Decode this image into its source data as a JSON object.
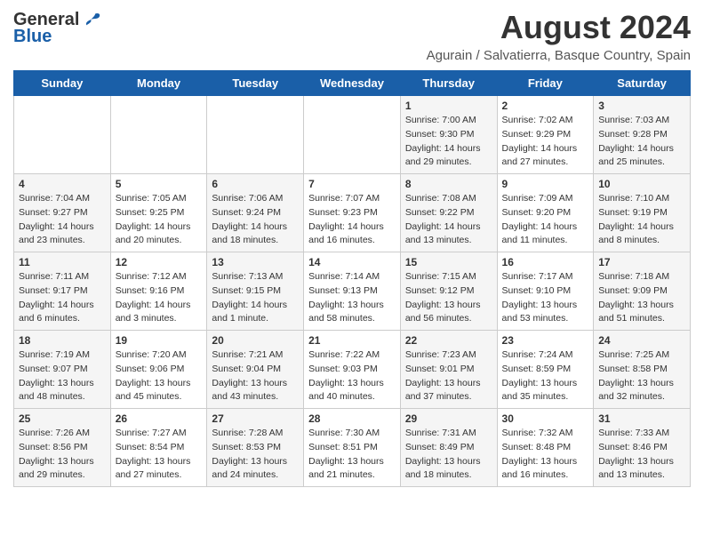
{
  "header": {
    "logo_general": "General",
    "logo_blue": "Blue",
    "month_year": "August 2024",
    "subtitle": "Agurain / Salvatierra, Basque Country, Spain"
  },
  "days_of_week": [
    "Sunday",
    "Monday",
    "Tuesday",
    "Wednesday",
    "Thursday",
    "Friday",
    "Saturday"
  ],
  "weeks": [
    [
      {
        "day": "",
        "sunrise": "",
        "sunset": "",
        "daylight": ""
      },
      {
        "day": "",
        "sunrise": "",
        "sunset": "",
        "daylight": ""
      },
      {
        "day": "",
        "sunrise": "",
        "sunset": "",
        "daylight": ""
      },
      {
        "day": "",
        "sunrise": "",
        "sunset": "",
        "daylight": ""
      },
      {
        "day": "1",
        "sunrise": "7:00 AM",
        "sunset": "9:30 PM",
        "daylight": "14 hours and 29 minutes."
      },
      {
        "day": "2",
        "sunrise": "7:02 AM",
        "sunset": "9:29 PM",
        "daylight": "14 hours and 27 minutes."
      },
      {
        "day": "3",
        "sunrise": "7:03 AM",
        "sunset": "9:28 PM",
        "daylight": "14 hours and 25 minutes."
      }
    ],
    [
      {
        "day": "4",
        "sunrise": "7:04 AM",
        "sunset": "9:27 PM",
        "daylight": "14 hours and 23 minutes."
      },
      {
        "day": "5",
        "sunrise": "7:05 AM",
        "sunset": "9:25 PM",
        "daylight": "14 hours and 20 minutes."
      },
      {
        "day": "6",
        "sunrise": "7:06 AM",
        "sunset": "9:24 PM",
        "daylight": "14 hours and 18 minutes."
      },
      {
        "day": "7",
        "sunrise": "7:07 AM",
        "sunset": "9:23 PM",
        "daylight": "14 hours and 16 minutes."
      },
      {
        "day": "8",
        "sunrise": "7:08 AM",
        "sunset": "9:22 PM",
        "daylight": "14 hours and 13 minutes."
      },
      {
        "day": "9",
        "sunrise": "7:09 AM",
        "sunset": "9:20 PM",
        "daylight": "14 hours and 11 minutes."
      },
      {
        "day": "10",
        "sunrise": "7:10 AM",
        "sunset": "9:19 PM",
        "daylight": "14 hours and 8 minutes."
      }
    ],
    [
      {
        "day": "11",
        "sunrise": "7:11 AM",
        "sunset": "9:17 PM",
        "daylight": "14 hours and 6 minutes."
      },
      {
        "day": "12",
        "sunrise": "7:12 AM",
        "sunset": "9:16 PM",
        "daylight": "14 hours and 3 minutes."
      },
      {
        "day": "13",
        "sunrise": "7:13 AM",
        "sunset": "9:15 PM",
        "daylight": "14 hours and 1 minute."
      },
      {
        "day": "14",
        "sunrise": "7:14 AM",
        "sunset": "9:13 PM",
        "daylight": "13 hours and 58 minutes."
      },
      {
        "day": "15",
        "sunrise": "7:15 AM",
        "sunset": "9:12 PM",
        "daylight": "13 hours and 56 minutes."
      },
      {
        "day": "16",
        "sunrise": "7:17 AM",
        "sunset": "9:10 PM",
        "daylight": "13 hours and 53 minutes."
      },
      {
        "day": "17",
        "sunrise": "7:18 AM",
        "sunset": "9:09 PM",
        "daylight": "13 hours and 51 minutes."
      }
    ],
    [
      {
        "day": "18",
        "sunrise": "7:19 AM",
        "sunset": "9:07 PM",
        "daylight": "13 hours and 48 minutes."
      },
      {
        "day": "19",
        "sunrise": "7:20 AM",
        "sunset": "9:06 PM",
        "daylight": "13 hours and 45 minutes."
      },
      {
        "day": "20",
        "sunrise": "7:21 AM",
        "sunset": "9:04 PM",
        "daylight": "13 hours and 43 minutes."
      },
      {
        "day": "21",
        "sunrise": "7:22 AM",
        "sunset": "9:03 PM",
        "daylight": "13 hours and 40 minutes."
      },
      {
        "day": "22",
        "sunrise": "7:23 AM",
        "sunset": "9:01 PM",
        "daylight": "13 hours and 37 minutes."
      },
      {
        "day": "23",
        "sunrise": "7:24 AM",
        "sunset": "8:59 PM",
        "daylight": "13 hours and 35 minutes."
      },
      {
        "day": "24",
        "sunrise": "7:25 AM",
        "sunset": "8:58 PM",
        "daylight": "13 hours and 32 minutes."
      }
    ],
    [
      {
        "day": "25",
        "sunrise": "7:26 AM",
        "sunset": "8:56 PM",
        "daylight": "13 hours and 29 minutes."
      },
      {
        "day": "26",
        "sunrise": "7:27 AM",
        "sunset": "8:54 PM",
        "daylight": "13 hours and 27 minutes."
      },
      {
        "day": "27",
        "sunrise": "7:28 AM",
        "sunset": "8:53 PM",
        "daylight": "13 hours and 24 minutes."
      },
      {
        "day": "28",
        "sunrise": "7:30 AM",
        "sunset": "8:51 PM",
        "daylight": "13 hours and 21 minutes."
      },
      {
        "day": "29",
        "sunrise": "7:31 AM",
        "sunset": "8:49 PM",
        "daylight": "13 hours and 18 minutes."
      },
      {
        "day": "30",
        "sunrise": "7:32 AM",
        "sunset": "8:48 PM",
        "daylight": "13 hours and 16 minutes."
      },
      {
        "day": "31",
        "sunrise": "7:33 AM",
        "sunset": "8:46 PM",
        "daylight": "13 hours and 13 minutes."
      }
    ]
  ],
  "labels": {
    "sunrise": "Sunrise:",
    "sunset": "Sunset:",
    "daylight": "Daylight:"
  }
}
